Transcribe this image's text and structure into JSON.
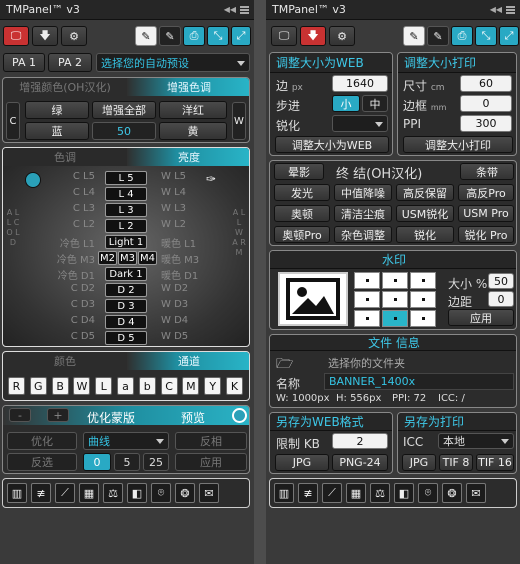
{
  "title": "TMPanel™ v3",
  "left": {
    "preset_a": "PA 1",
    "preset_b": "PA 2",
    "preset_select": "选择您的自动预设",
    "enhance": {
      "left_hdr": "增强颜色(OH汉化)",
      "right_hdr": "增强色调",
      "side_c": "C",
      "side_w": "W",
      "b_green": "绿",
      "b_all": "增强全部",
      "b_magenta": "洋红",
      "b_blue": "蓝",
      "b_value": "50",
      "b_yellow": "黄"
    },
    "tones": {
      "hdr_left": "色调",
      "hdr_right": "亮度",
      "all_cold": "A L L C O L D",
      "all_warm": "A L L W A R M",
      "rows": [
        {
          "l": "C L5",
          "c": "L 5",
          "r": "W L5"
        },
        {
          "l": "C L4",
          "c": "L 4",
          "r": "W L4"
        },
        {
          "l": "C L3",
          "c": "L 3",
          "r": "W L3"
        },
        {
          "l": "C L2",
          "c": "L 2",
          "r": "W L2"
        },
        {
          "l": "冷色 L1",
          "c": "Light 1",
          "r": "暖色 L1"
        },
        {
          "l": "冷色 M3",
          "c": "M2",
          "c2": "M3",
          "c3": "M4",
          "r": "暖色 M3"
        },
        {
          "l": "冷色 D1",
          "c": "Dark 1",
          "r": "暖色 D1"
        },
        {
          "l": "C D2",
          "c": "D 2",
          "r": "W D2"
        },
        {
          "l": "C D3",
          "c": "D 3",
          "r": "W D3"
        },
        {
          "l": "C D4",
          "c": "D 4",
          "r": "W D4"
        },
        {
          "l": "C D5",
          "c": "D 5",
          "r": "W D5"
        }
      ]
    },
    "channels": {
      "hdr_left": "颜色",
      "hdr_right": "通道",
      "letters": [
        "R",
        "G",
        "B",
        "W",
        "L",
        "a",
        "b",
        "C",
        "M",
        "Y",
        "K"
      ]
    },
    "opt": {
      "minus": "-",
      "plus": "+",
      "title": "优化蒙版",
      "preview": "预览",
      "optimize": "优化",
      "curve": "曲线",
      "invert": "反相",
      "invert2": "反选",
      "v0": "0",
      "v5": "5",
      "v25": "25",
      "apply": "应用"
    }
  },
  "right": {
    "web": {
      "title": "调整大小为WEB",
      "edge": "边",
      "edge_unit": "px",
      "edge_val": "1640",
      "step": "步进",
      "small": "小",
      "mid": "中",
      "sharpen": "锐化",
      "resize_btn": "调整大小为WEB"
    },
    "print": {
      "title": "调整大小打印",
      "size": "尺寸",
      "size_unit": "cm",
      "size_val": "60",
      "border": "边框",
      "border_unit": "mm",
      "border_val": "0",
      "ppi": "PPI",
      "ppi_val": "300",
      "resize_btn": "调整大小打印"
    },
    "finish": {
      "halo": "晕影",
      "title": "终 结(OH汉化)",
      "strip": "条带",
      "glow": "发光",
      "median": "中值降噪",
      "hp_keep": "高反保留",
      "hp_pro": "高反Pro",
      "orton": "奥顿",
      "clean_dust": "清洁尘痕",
      "usm": "USM锐化",
      "usm_pro": "USM Pro",
      "orton_pro": "奥顿Pro",
      "noise_adj": "杂色调整",
      "sharpen": "锐化",
      "sharpen_pro": "锐化 Pro"
    },
    "watermark": {
      "title": "水印",
      "size": "大小 %",
      "size_val": "50",
      "margin": "边距",
      "margin_val": "0",
      "apply": "应用"
    },
    "file": {
      "title": "文件  信息",
      "choose": "选择你的文件夹",
      "name_lbl": "名称",
      "name_val": "BANNER_1400x",
      "w": "W: 1000px",
      "h": "H: 556px",
      "ppi": "PPI: 72",
      "icc": "ICC: /"
    },
    "saveweb": {
      "title": "另存为WEB格式",
      "limit": "限制 KB",
      "limit_val": "2",
      "jpg": "JPG",
      "png": "PNG-24"
    },
    "saveprint": {
      "title": "另存为打印",
      "icc": "ICC",
      "icc_val": "本地",
      "jpg": "JPG",
      "tif8": "TIF 8",
      "tif16": "TIF 16"
    }
  },
  "colors": {
    "accent": "#29b5c8",
    "red": "#c93232"
  }
}
